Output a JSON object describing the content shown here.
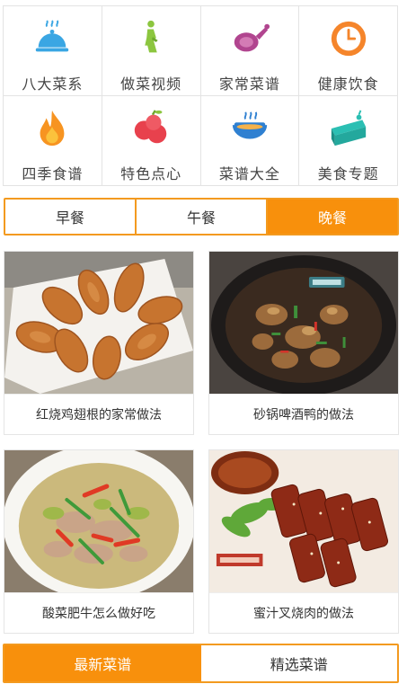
{
  "categories": [
    {
      "label": "八大菜系",
      "icon": "cloche-icon",
      "color": "#3aa6e3"
    },
    {
      "label": "做菜视频",
      "icon": "figure-icon",
      "color": "#8cc63f"
    },
    {
      "label": "家常菜谱",
      "icon": "ham-leg-icon",
      "color": "#b1458f"
    },
    {
      "label": "健康饮食",
      "icon": "clock-icon",
      "color": "#f5852b"
    },
    {
      "label": "四季食谱",
      "icon": "flame-icon",
      "color": "#f79421"
    },
    {
      "label": "特色点心",
      "icon": "apple-icon",
      "color": "#e8414d"
    },
    {
      "label": "菜谱大全",
      "icon": "bowl-icon",
      "color": "#2f80d1"
    },
    {
      "label": "美食专题",
      "icon": "cake-icon",
      "color": "#2bbfb3"
    }
  ],
  "meal_tabs": [
    {
      "label": "早餐",
      "active": false
    },
    {
      "label": "午餐",
      "active": false
    },
    {
      "label": "晚餐",
      "active": true
    }
  ],
  "recipes": [
    {
      "title": "红烧鸡翅根的家常做法",
      "image": "chicken-drumettes-photo"
    },
    {
      "title": "砂锅啤酒鸭的做法",
      "image": "beer-duck-claypot-photo"
    },
    {
      "title": "酸菜肥牛怎么做好吃",
      "image": "pickled-cabbage-beef-photo"
    },
    {
      "title": "蜜汁叉烧肉的做法",
      "image": "char-siu-pork-photo"
    }
  ],
  "bottom_tabs": [
    {
      "label": "最新菜谱",
      "active": true
    },
    {
      "label": "精选菜谱",
      "active": false
    }
  ],
  "colors": {
    "accent": "#f8900c",
    "accent_border": "#f39a1f"
  }
}
